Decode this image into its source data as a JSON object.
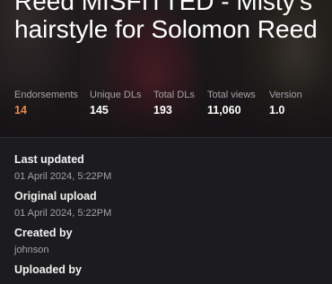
{
  "mod": {
    "title": "Reed MISFITTED - Misty's hairstyle for Solomon Reed"
  },
  "stats": [
    {
      "label": "Endorsements",
      "value": "14"
    },
    {
      "label": "Unique DLs",
      "value": "145"
    },
    {
      "label": "Total DLs",
      "value": "193"
    },
    {
      "label": "Total views",
      "value": "11,060"
    },
    {
      "label": "Version",
      "value": "1.0"
    }
  ],
  "details": {
    "last_updated": {
      "label": "Last updated",
      "value": "01 April 2024, 5:22PM"
    },
    "original_upload": {
      "label": "Original upload",
      "value": "01 April 2024, 5:22PM"
    },
    "created_by": {
      "label": "Created by",
      "value": "johnson"
    },
    "uploaded_by": {
      "label": "Uploaded by",
      "value": ""
    }
  },
  "colors": {
    "accent": "#e88a4a",
    "background": "#1c1c1f",
    "muted_text": "#a3a3a8"
  }
}
